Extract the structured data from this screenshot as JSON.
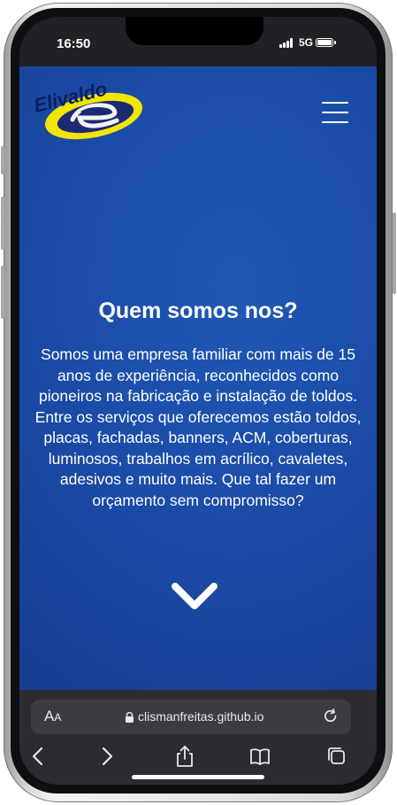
{
  "status_bar": {
    "time": "16:50",
    "network": "5G",
    "icons": [
      "signal-icon",
      "battery-icon"
    ]
  },
  "site": {
    "logo_text": "Elivaldo",
    "logo_colors": {
      "navy": "#1b2a73",
      "yellow": "#f2e600"
    },
    "menu_icon": "hamburger-icon",
    "heading": "Quem somos nos?",
    "paragraph": "Somos uma empresa familiar com mais de 15 anos de experiência, reconhecidos como pioneiros na fabricação e instalação de toldos. Entre os serviços que oferecemos estão toldos, placas, fachadas, banners, ACM, coberturas, luminosos, trabalhos em acrílico, cavaletes, adesivos e muito mais. Que tal fazer um orçamento sem compromisso?",
    "scroll_icon": "chevron-down-icon",
    "background": "#1a4aa5"
  },
  "browser": {
    "aa_big": "A",
    "aa_small": "A",
    "url": "clismanfreitas.github.io",
    "toolbar_icons": [
      "back-icon",
      "forward-icon",
      "share-icon",
      "bookmarks-icon",
      "tabs-icon"
    ],
    "background": "#2b2c30"
  }
}
